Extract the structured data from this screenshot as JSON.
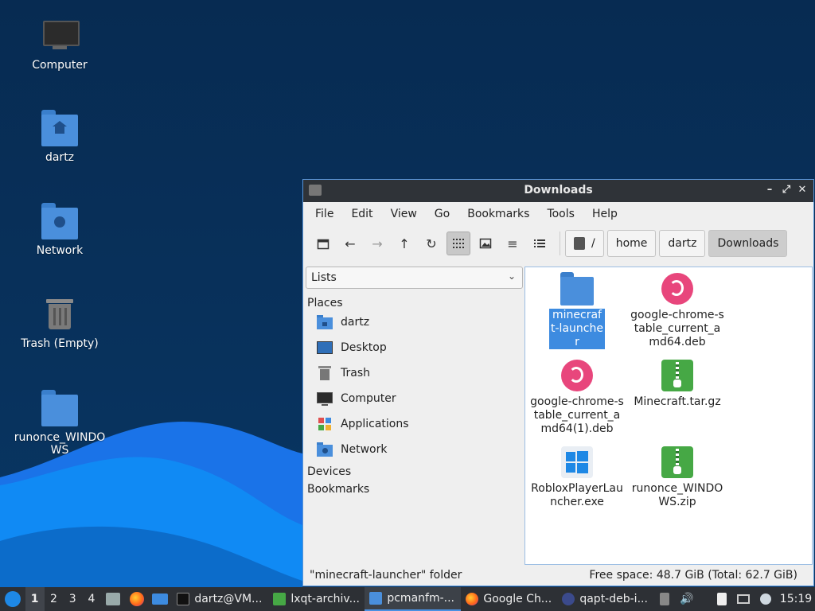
{
  "desktop": {
    "icons": [
      {
        "label": "Computer",
        "icon": "monitor-icon"
      },
      {
        "label": "dartz",
        "icon": "home-folder-icon"
      },
      {
        "label": "Network",
        "icon": "network-folder-icon"
      },
      {
        "label": "Trash (Empty)",
        "icon": "trash-icon"
      },
      {
        "label": "runonce_WINDOWS",
        "icon": "folder-icon"
      }
    ]
  },
  "window": {
    "title": "Downloads",
    "menu": [
      "File",
      "Edit",
      "View",
      "Go",
      "Bookmarks",
      "Tools",
      "Help"
    ],
    "path": [
      "/",
      "home",
      "dartz",
      "Downloads"
    ],
    "side_selector": "Lists",
    "places_header": "Places",
    "places": [
      {
        "label": "dartz",
        "icon": "home-folder-icon"
      },
      {
        "label": "Desktop",
        "icon": "desktop-icon"
      },
      {
        "label": "Trash",
        "icon": "trash-icon"
      },
      {
        "label": "Computer",
        "icon": "monitor-icon"
      },
      {
        "label": "Applications",
        "icon": "applications-icon"
      },
      {
        "label": "Network",
        "icon": "network-folder-icon"
      }
    ],
    "devices_header": "Devices",
    "bookmarks_header": "Bookmarks",
    "files": [
      {
        "name": "minecraft-launcher",
        "icon": "folder-icon",
        "selected": true
      },
      {
        "name": "google-chrome-stable_current_amd64.deb",
        "icon": "debian-package-icon"
      },
      {
        "name": "google-chrome-stable_current_amd64(1).deb",
        "icon": "debian-package-icon"
      },
      {
        "name": "Minecraft.tar.gz",
        "icon": "archive-icon"
      },
      {
        "name": "RobloxPlayerLauncher.exe",
        "icon": "windows-exe-icon"
      },
      {
        "name": "runonce_WINDOWS.zip",
        "icon": "archive-icon"
      }
    ],
    "status_left": "\"minecraft-launcher\" folder",
    "status_right": "Free space: 48.7 GiB (Total: 62.7 GiB)"
  },
  "taskbar": {
    "desktops": [
      "1",
      "2",
      "3",
      "4"
    ],
    "tasks": [
      {
        "label": "dartz@VM...",
        "icon": "terminal-icon"
      },
      {
        "label": "lxqt-archiv...",
        "icon": "archive-icon"
      },
      {
        "label": "pcmanfm-...",
        "icon": "folder-icon",
        "active": true
      },
      {
        "label": "Google Ch...",
        "icon": "firefox-icon"
      },
      {
        "label": "qapt-deb-i...",
        "icon": "package-installer-icon"
      }
    ],
    "clock": "15:19"
  },
  "colors": {
    "accent": "#3d8be0",
    "folder": "#4a8fdc",
    "debian": "#e8467c",
    "archive": "#46a845",
    "titlebar": "#2f3338",
    "taskbar": "#2d3035"
  }
}
